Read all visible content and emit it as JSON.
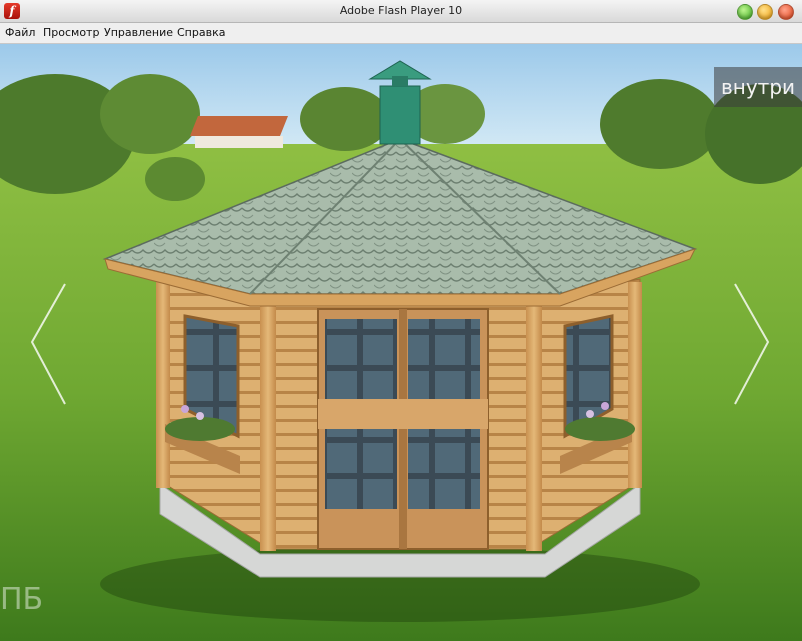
{
  "window": {
    "title": "Adobe Flash Player 10"
  },
  "menu": {
    "items": [
      "Файл",
      "Просмотр",
      "Управление",
      "Справка"
    ]
  },
  "stage": {
    "inside_button": "внутри",
    "watermark": "ПБ"
  },
  "icons": [
    "flash-player-icon",
    "prev-arrow-icon",
    "next-arrow-icon"
  ],
  "colors": {
    "roof": "#9fb4a3",
    "chimney": "#2f8f74",
    "wood": "#d9a867",
    "grass": "#6fa832"
  }
}
